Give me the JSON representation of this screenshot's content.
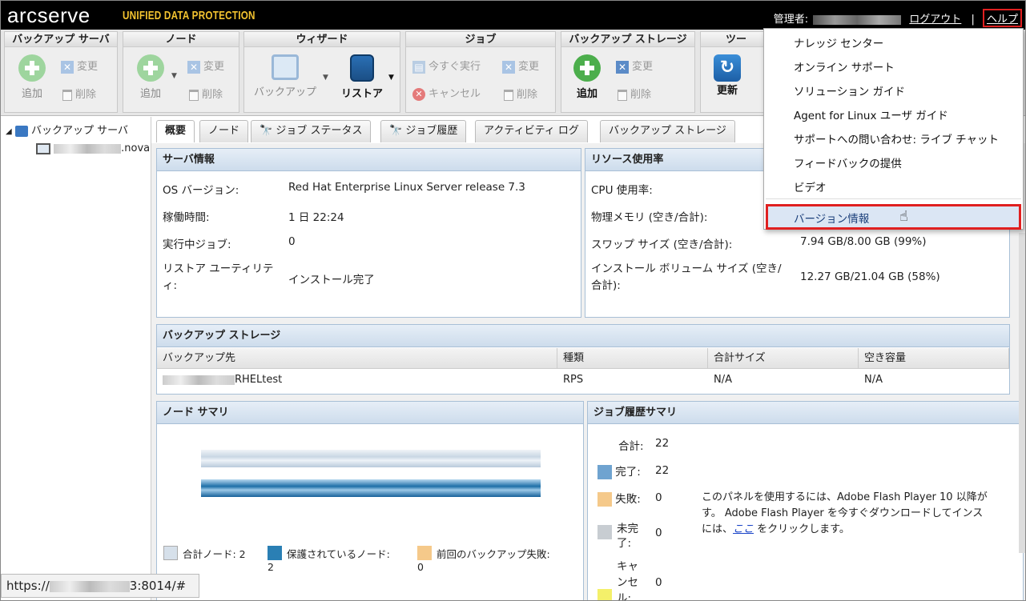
{
  "header": {
    "logo": "arcserve",
    "logo_sub": "UNIFIED DATA PROTECTION",
    "admin_label": "管理者:",
    "logout": "ログアウト",
    "separator": "|",
    "help": "ヘルプ"
  },
  "toolbar": {
    "backup_server": {
      "title": "バックアップ サーバ",
      "add": "追加",
      "modify": "変更",
      "delete": "削除"
    },
    "node": {
      "title": "ノード",
      "add": "追加",
      "modify": "変更",
      "delete": "削除"
    },
    "wizard": {
      "title": "ウィザード",
      "backup": "バックアップ",
      "restore": "リストア"
    },
    "job": {
      "title": "ジョブ",
      "run_now": "今すぐ実行",
      "cancel": "キャンセル",
      "modify": "変更",
      "delete": "削除"
    },
    "backup_storage": {
      "title": "バックアップ ストレージ",
      "add": "追加",
      "modify": "変更",
      "delete": "削除"
    },
    "tools": {
      "title": "ツー",
      "refresh": "更新"
    }
  },
  "tree": {
    "root": "バックアップ サーバ",
    "child_suffix": ".nova"
  },
  "tabs": [
    "概要",
    "ノード",
    "ジョブ ステータス",
    "ジョブ履歴",
    "アクティビティ ログ",
    "バックアップ ストレージ"
  ],
  "server_info": {
    "title": "サーバ情報",
    "rows": [
      {
        "label": "OS バージョン:",
        "value": "Red Hat Enterprise Linux Server release 7.3"
      },
      {
        "label": "稼働時間:",
        "value": "1 日 22:24"
      },
      {
        "label": "実行中ジョブ:",
        "value": "0"
      },
      {
        "label": "リストア ユーティリティ:",
        "value": "インストール完了"
      }
    ]
  },
  "resource": {
    "title": "リソース使用率",
    "rows": [
      {
        "label": "CPU 使用率:",
        "value": ""
      },
      {
        "label": "物理メモリ (空き/合計):",
        "value": ""
      },
      {
        "label": "スワップ サイズ (空き/合計):",
        "value": "7.94 GB/8.00 GB (99%)"
      },
      {
        "label": "インストール ボリューム サイズ (空き/合計):",
        "value": "12.27 GB/21.04 GB (58%)"
      }
    ]
  },
  "backup_storage": {
    "title": "バックアップ ストレージ",
    "columns": [
      "バックアップ先",
      "種類",
      "合計サイズ",
      "空き容量"
    ],
    "rows": [
      {
        "dest": "RHELtest",
        "type": "RPS",
        "total": "N/A",
        "free": "N/A"
      }
    ]
  },
  "node_summary": {
    "title": "ノード サマリ",
    "legend": [
      {
        "label": "合計ノード: 2",
        "color": "#d6e0ea"
      },
      {
        "label": "保護されているノード: 2",
        "color": "#2a7fb4"
      },
      {
        "label": "前回のバックアップ失敗: 0",
        "color": "#f5c98a"
      }
    ]
  },
  "job_summary": {
    "title": "ジョブ履歴サマリ",
    "total_label": "合計:",
    "total": "22",
    "items": [
      {
        "label": "完了:",
        "value": "22",
        "color": "#6fa3d0"
      },
      {
        "label": "失敗:",
        "value": "0",
        "color": "#f5c98a"
      },
      {
        "label": "未完了:",
        "value": "0",
        "color": "#c8cdd2"
      },
      {
        "label": "キャンセル:",
        "value": "0",
        "color": "#f4f06a"
      }
    ],
    "flash_msg1": "このパネルを使用するには、Adobe Flash Player 10 以降が",
    "flash_msg2": "す。 Adobe Flash Player を今すぐダウンロードしてインス",
    "flash_msg3a": "には、",
    "flash_link": "ここ",
    "flash_msg3b": " をクリックします。"
  },
  "help_menu": {
    "items": [
      "ナレッジ センター",
      "オンライン サポート",
      "ソリューション ガイド",
      "Agent for Linux ユーザ ガイド",
      "サポートへの問い合わせ: ライブ チャット",
      "フィードバックの提供",
      "ビデオ"
    ],
    "version": "バージョン情報"
  },
  "status_bar": {
    "prefix": "https://",
    "suffix": "3:8014/#"
  }
}
